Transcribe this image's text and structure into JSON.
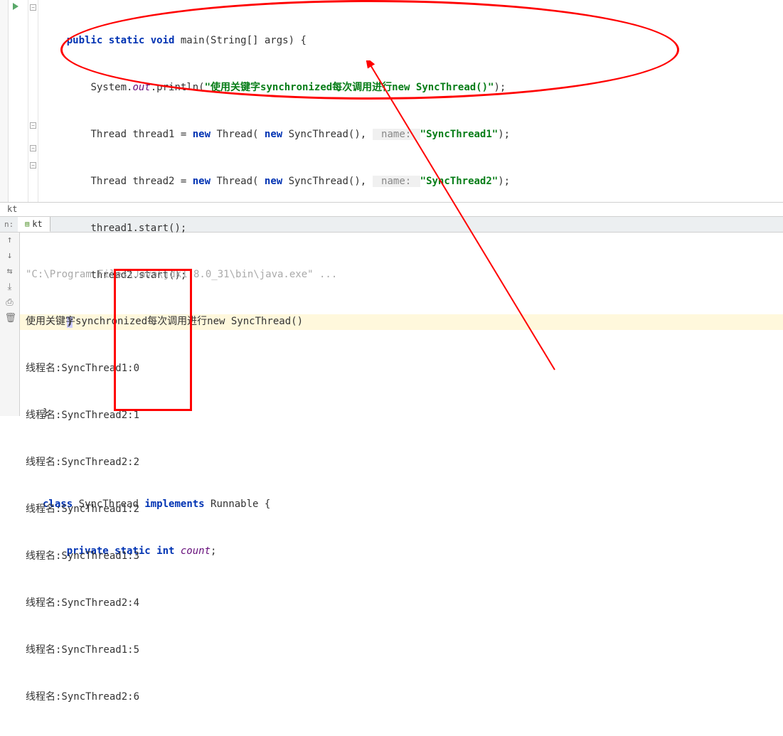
{
  "code": {
    "line1_kw1": "public static void",
    "line1_rest": " main(String[] args) {",
    "line2_a": "System.",
    "line2_b": "out",
    "line2_c": ".println(",
    "line2_str": "\"使用关键字synchronized每次调用进行new SyncThread()\"",
    "line2_d": ");",
    "line3_a": "Thread thread1 = ",
    "line3_new": "new",
    "line3_b": " Thread( ",
    "line3_c": " SyncThread(), ",
    "line3_hint": " name: ",
    "line3_str": "\"SyncThread1\"",
    "line3_d": ");",
    "line4_a": "Thread thread2 = ",
    "line4_b": " Thread( ",
    "line4_c": " SyncThread(), ",
    "line4_hint": " name: ",
    "line4_str": "\"SyncThread2\"",
    "line4_d": ");",
    "line5": "thread1.start();",
    "line6": "thread2.start();",
    "line7": "}",
    "line8": "}",
    "line9_a": "class",
    "line9_b": " SyncThread ",
    "line9_c": "implements",
    "line9_d": " Runnable {",
    "line10_a": "private static int",
    "line10_b": " ",
    "line10_c": "count",
    "line10_d": ";"
  },
  "breadcrumb": "kt",
  "tab_label": "n:",
  "tab_name": "kt",
  "console": {
    "cmd": "\"C:\\Program Files\\Java\\jdk1.8.0_31\\bin\\java.exe\" ...",
    "lines": [
      "使用关键字synchronized每次调用进行new SyncThread()",
      "线程名:SyncThread1:0",
      "线程名:SyncThread2:1",
      "线程名:SyncThread2:2",
      "线程名:SyncThread1:2",
      "线程名:SyncThread1:3",
      "线程名:SyncThread2:4",
      "线程名:SyncThread1:5",
      "线程名:SyncThread2:6"
    ]
  }
}
